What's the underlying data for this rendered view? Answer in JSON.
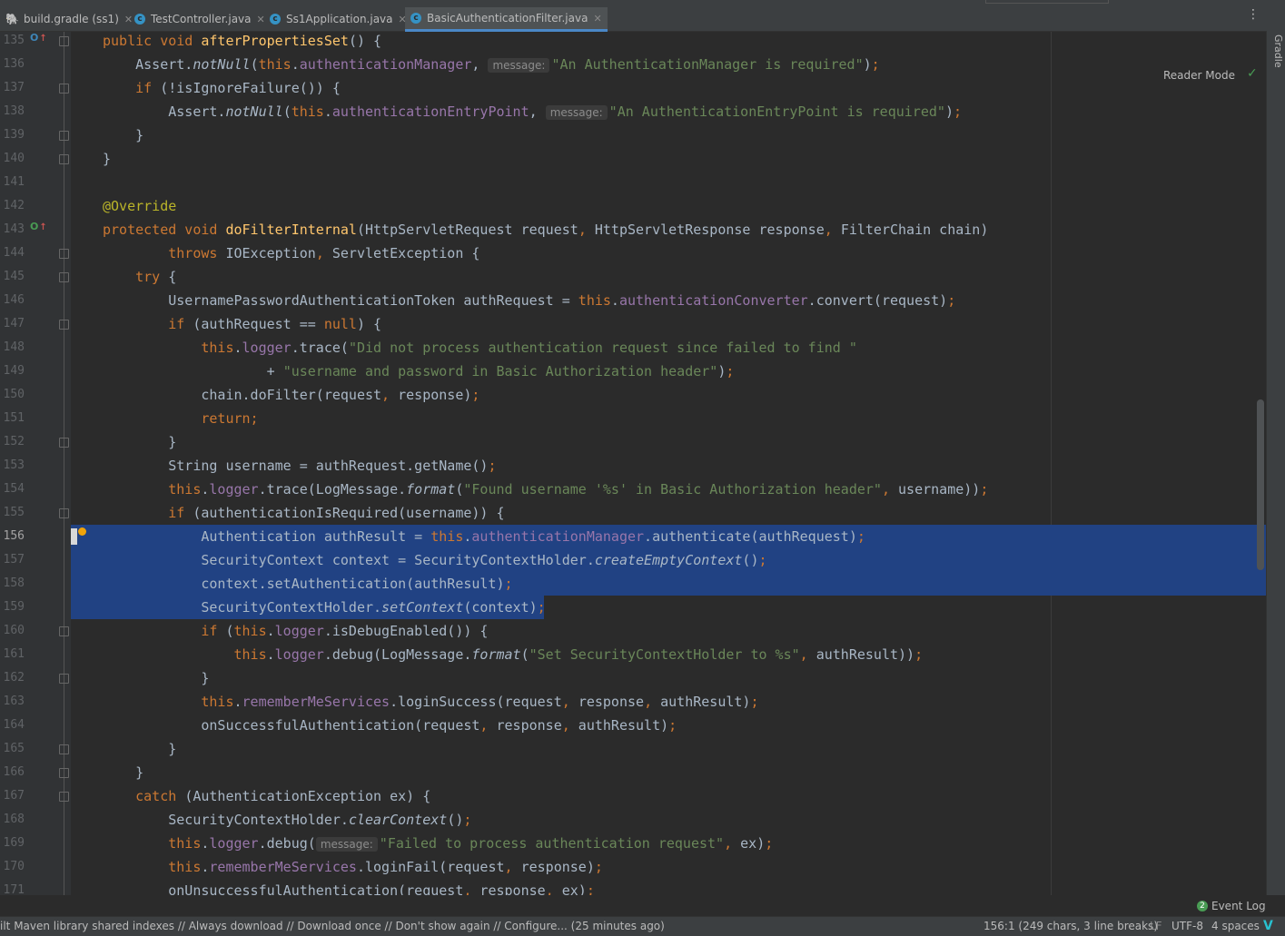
{
  "tabs": [
    {
      "label": "build.gradle (ss1)",
      "icon": "gradle-icon",
      "active": false
    },
    {
      "label": "TestController.java",
      "icon": "java-class-icon",
      "active": false
    },
    {
      "label": "Ss1Application.java",
      "icon": "java-class-icon",
      "active": false
    },
    {
      "label": "BasicAuthenticationFilter.java",
      "icon": "java-class-icon",
      "active": true
    }
  ],
  "tabbar_menu": "⋮",
  "right_panel": {
    "gradle_label": "Gradle"
  },
  "editor": {
    "reader_mode_label": "Reader Mode",
    "current_line": 156,
    "selection": {
      "from_line": 156,
      "to_line": 159
    },
    "lines": [
      {
        "n": "135",
        "html": "<span class=\"kw\">public void </span><span class=\"fn\">afterPropertiesSet</span>() {"
      },
      {
        "n": "136",
        "html": "    Assert.<span class=\"it\">notNull</span>(<span class=\"kw\">this</span>.<span class=\"fld\">authenticationManager</span>, <span class=\"hint\">message:</span><span class=\"str\">\"An AuthenticationManager is required\"</span>)<span class=\"kw\">;</span>"
      },
      {
        "n": "137",
        "html": "    <span class=\"kw\">if </span>(!isIgnoreFailure()) {"
      },
      {
        "n": "138",
        "html": "        Assert.<span class=\"it\">notNull</span>(<span class=\"kw\">this</span>.<span class=\"fld\">authenticationEntryPoint</span>, <span class=\"hint\">message:</span><span class=\"str\">\"An AuthenticationEntryPoint is required\"</span>)<span class=\"kw\">;</span>"
      },
      {
        "n": "139",
        "html": "    }"
      },
      {
        "n": "140",
        "html": "}"
      },
      {
        "n": "141",
        "html": ""
      },
      {
        "n": "142",
        "html": "<span class=\"ann\">@Override</span>"
      },
      {
        "n": "143",
        "html": "<span class=\"kw\">protected void </span><span class=\"fn\">doFilterInternal</span>(HttpServletRequest request<span class=\"kw\">, </span>HttpServletResponse response<span class=\"kw\">, </span>FilterChain chain)"
      },
      {
        "n": "144",
        "html": "        <span class=\"kw\">throws </span>IOException<span class=\"kw\">, </span>ServletException {"
      },
      {
        "n": "145",
        "html": "    <span class=\"kw\">try </span>{"
      },
      {
        "n": "146",
        "html": "        UsernamePasswordAuthenticationToken authRequest = <span class=\"kw\">this</span>.<span class=\"fld\">authenticationConverter</span>.convert(request)<span class=\"kw\">;</span>"
      },
      {
        "n": "147",
        "html": "        <span class=\"kw\">if </span>(authRequest == <span class=\"kw\">null</span>) {"
      },
      {
        "n": "148",
        "html": "            <span class=\"kw\">this</span>.<span class=\"fld\">logger</span>.trace(<span class=\"str\">\"Did not process authentication request since failed to find \"</span>"
      },
      {
        "n": "149",
        "html": "                    + <span class=\"str\">\"username and password in Basic Authorization header\"</span>)<span class=\"kw\">;</span>"
      },
      {
        "n": "150",
        "html": "            chain.doFilter(request<span class=\"kw\">, </span>response)<span class=\"kw\">;</span>"
      },
      {
        "n": "151",
        "html": "            <span class=\"kw\">return;</span>"
      },
      {
        "n": "152",
        "html": "        }"
      },
      {
        "n": "153",
        "html": "        String username = authRequest.getName()<span class=\"kw\">;</span>"
      },
      {
        "n": "154",
        "html": "        <span class=\"kw\">this</span>.<span class=\"fld\">logger</span>.trace(LogMessage.<span class=\"it\">format</span>(<span class=\"str\">\"Found username '%s' in Basic Authorization header\"</span><span class=\"kw\">, </span>username))<span class=\"kw\">;</span>"
      },
      {
        "n": "155",
        "html": "        <span class=\"kw\">if </span>(authenticationIsRequired(username)) {"
      },
      {
        "n": "156",
        "html": "            Authentication authResult = <span class=\"kw\">this</span>.<span class=\"fld\">authenticationManager</span>.authenticate(authRequest)<span class=\"kw\">;</span>"
      },
      {
        "n": "157",
        "html": "            SecurityContext context = SecurityContextHolder.<span class=\"it\">createEmptyContext</span>()<span class=\"kw\">;</span>"
      },
      {
        "n": "158",
        "html": "            context.setAuthentication(authResult)<span class=\"kw\">;</span>"
      },
      {
        "n": "159",
        "html": "            SecurityContextHolder.<span class=\"it\">setContext</span>(context)<span class=\"kw\">;</span>"
      },
      {
        "n": "160",
        "html": "            <span class=\"kw\">if </span>(<span class=\"kw\">this</span>.<span class=\"fld\">logger</span>.isDebugEnabled()) {"
      },
      {
        "n": "161",
        "html": "                <span class=\"kw\">this</span>.<span class=\"fld\">logger</span>.debug(LogMessage.<span class=\"it\">format</span>(<span class=\"str\">\"Set SecurityContextHolder to %s\"</span><span class=\"kw\">, </span>authResult))<span class=\"kw\">;</span>"
      },
      {
        "n": "162",
        "html": "            }"
      },
      {
        "n": "163",
        "html": "            <span class=\"kw\">this</span>.<span class=\"fld\">rememberMeServices</span>.loginSuccess(request<span class=\"kw\">, </span>response<span class=\"kw\">, </span>authResult)<span class=\"kw\">;</span>"
      },
      {
        "n": "164",
        "html": "            onSuccessfulAuthentication(request<span class=\"kw\">, </span>response<span class=\"kw\">, </span>authResult)<span class=\"kw\">;</span>"
      },
      {
        "n": "165",
        "html": "        }"
      },
      {
        "n": "166",
        "html": "    }"
      },
      {
        "n": "167",
        "html": "    <span class=\"kw\">catch </span>(AuthenticationException ex) {"
      },
      {
        "n": "168",
        "html": "        SecurityContextHolder.<span class=\"it\">clearContext</span>()<span class=\"kw\">;</span>"
      },
      {
        "n": "169",
        "html": "        <span class=\"kw\">this</span>.<span class=\"fld\">logger</span>.debug(<span class=\"hint\">message:</span><span class=\"str\">\"Failed to process authentication request\"</span><span class=\"kw\">, </span>ex)<span class=\"kw\">;</span>"
      },
      {
        "n": "170",
        "html": "        <span class=\"kw\">this</span>.<span class=\"fld\">rememberMeServices</span>.loginFail(request<span class=\"kw\">, </span>response)<span class=\"kw\">;</span>"
      },
      {
        "n": "171",
        "html": "        onUnsuccessfulAuthentication(request<span class=\"kw\">, </span>response<span class=\"kw\">, </span>ex)<span class=\"kw\">;</span>"
      }
    ],
    "gutter_markers": [
      {
        "line": "135",
        "kind": "overrides-icon",
        "glyph": "O"
      },
      {
        "line": "143",
        "kind": "implements-icon",
        "glyph": "O"
      }
    ],
    "fold_lines": [
      "135",
      "137",
      "139",
      "140",
      "144",
      "145",
      "147",
      "152",
      "155",
      "160",
      "162",
      "165",
      "166",
      "167"
    ]
  },
  "event_log": {
    "badge": "2",
    "label": "Event Log"
  },
  "status": {
    "message": "ilt Maven library shared indexes // Always download // Download once // Don't show again // Configure... (25 minutes ago)",
    "position": "156:1 (249 chars, 3 line breaks)",
    "line_separator": "LF",
    "encoding": "UTF-8",
    "indent": "4 spaces"
  },
  "colors": {
    "keyword": "#cc7832",
    "field": "#9876aa",
    "string": "#6a8759",
    "annotation": "#bbb529",
    "method_decl": "#ffc66d",
    "selection": "#214283",
    "background": "#2b2b2b"
  }
}
